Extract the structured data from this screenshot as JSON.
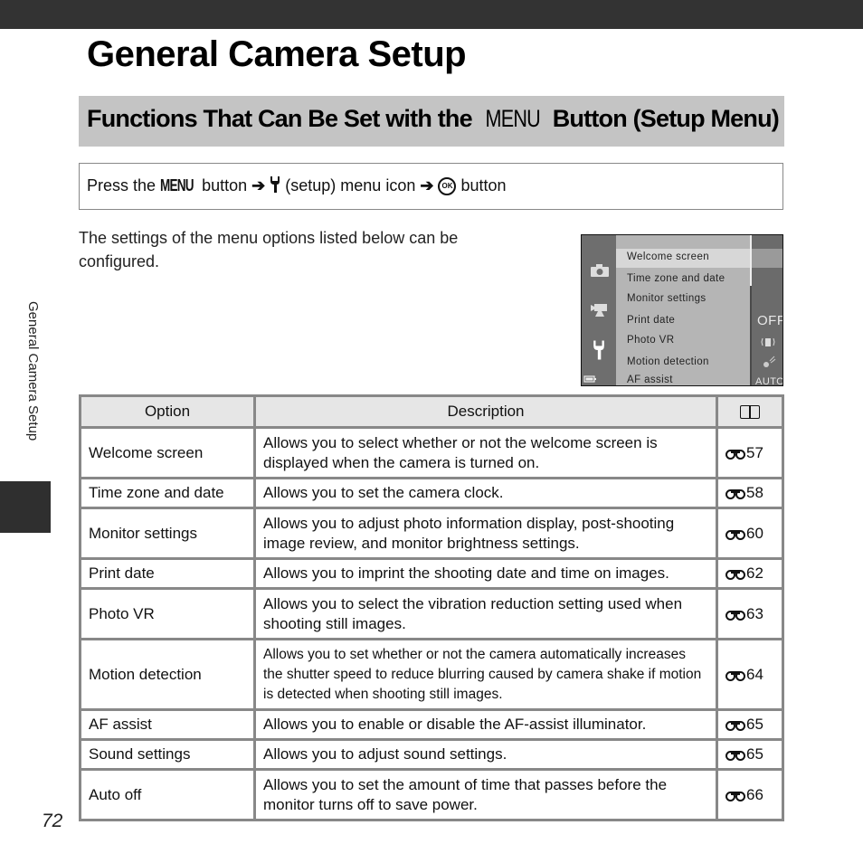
{
  "page": {
    "title": "General Camera Setup",
    "side_label": "General Camera Setup",
    "page_number": "72"
  },
  "section": {
    "title_before": "Functions That Can Be Set with the",
    "menu_word": "MENU",
    "title_after": "Button (Setup Menu)"
  },
  "procedure": {
    "press": "Press the",
    "menu_word": "MENU",
    "button1": "button",
    "arrow": "➔",
    "setup_text": "(setup) menu icon",
    "ok_label": "OK",
    "button2": "button"
  },
  "intro": "The settings of the menu options listed below can be configured.",
  "camera_screen": {
    "items": [
      "Welcome screen",
      "Time zone and date",
      "Monitor settings",
      "Print date",
      "Photo VR",
      "Motion detection",
      "AF assist"
    ],
    "selected_index": 0,
    "values": [
      "OFF",
      "AUTO"
    ]
  },
  "table": {
    "headers": [
      "Option",
      "Description"
    ],
    "header_ref_icon": "book-icon",
    "rows": [
      {
        "option": "Welcome screen",
        "description": "Allows you to select whether or not the welcome screen is displayed when the camera is turned on.",
        "ref": "57"
      },
      {
        "option": "Time zone and date",
        "description": "Allows you to set the camera clock.",
        "ref": "58"
      },
      {
        "option": "Monitor settings",
        "description": "Allows you to adjust photo information display, post-shooting image review, and monitor brightness settings.",
        "ref": "60"
      },
      {
        "option": "Print date",
        "description": "Allows you to imprint the shooting date and time on images.",
        "ref": "62"
      },
      {
        "option": "Photo VR",
        "description": "Allows you to select the vibration reduction setting used when shooting still images.",
        "ref": "63"
      },
      {
        "option": "Motion detection",
        "description": "Allows you to set whether or not the camera automatically increases the shutter speed to reduce blurring caused by camera shake if motion is detected when shooting still images.",
        "ref": "64"
      },
      {
        "option": "AF assist",
        "description": "Allows you to enable or disable the AF-assist illuminator.",
        "ref": "65"
      },
      {
        "option": "Sound settings",
        "description": "Allows you to adjust sound settings.",
        "ref": "65"
      },
      {
        "option": "Auto off",
        "description": "Allows you to set the amount of time that passes before the monitor turns off to save power.",
        "ref": "66"
      }
    ]
  }
}
